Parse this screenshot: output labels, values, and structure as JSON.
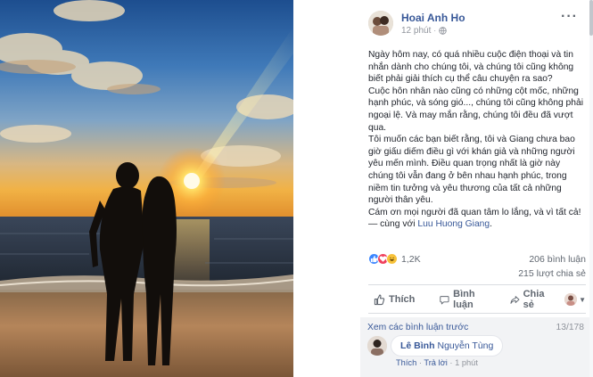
{
  "post": {
    "author": "Hoai Anh Ho",
    "time": "12 phút",
    "time_separator": "·",
    "audience_icon": "globe-icon",
    "more_label": "···",
    "paragraphs": [
      "Ngày hôm nay, có quá nhiều cuộc điện thoại và tin nhắn dành cho chúng tôi, và chúng tôi cũng không biết phải giải thích cụ thể câu chuyện ra sao?",
      "Cuộc hôn nhân nào cũng có những cột mốc, những hạnh phúc, và sóng gió..., chúng tôi cũng không phải ngoại lệ. Và may mắn rằng, chúng tôi đều đã vượt qua.",
      "Tôi muốn các bạn biết rằng, tôi và Giang chưa bao giờ giấu diếm điều gì với khán giả và những người yêu mến mình. Điều quan trọng nhất là giờ này chúng tôi vẫn đang ở bên nhau hạnh phúc, trong niềm tin tưởng và yêu thương của tất cả những người thân yêu."
    ],
    "last_paragraph": "Cám ơn mọi người đã quan tâm lo lắng, và vì tất cả!",
    "with_prefix": " — cùng với ",
    "tagged": "Luu Huong Giang",
    "tagged_suffix": "."
  },
  "stats": {
    "reaction_count": "1,2K",
    "reactions": [
      "like",
      "love",
      "haha"
    ],
    "comments": "206 bình luận",
    "shares": "215 lượt chia sẻ"
  },
  "actions": {
    "like": "Thích",
    "comment": "Bình luận",
    "share": "Chia sẻ"
  },
  "comments": {
    "view_previous": "Xem các bình luận trước",
    "page": "13/178",
    "first": {
      "name": "Lê Bình",
      "text": "Nguyễn Tùng",
      "like": "Thích",
      "reply": "Trả lời",
      "sep": " · ",
      "time": "1 phút"
    }
  },
  "colors": {
    "link": "#385898",
    "muted": "#90949c",
    "like_blue": "#3b86ff",
    "love_red": "#f0405c",
    "haha_yellow": "#f7c23a"
  }
}
